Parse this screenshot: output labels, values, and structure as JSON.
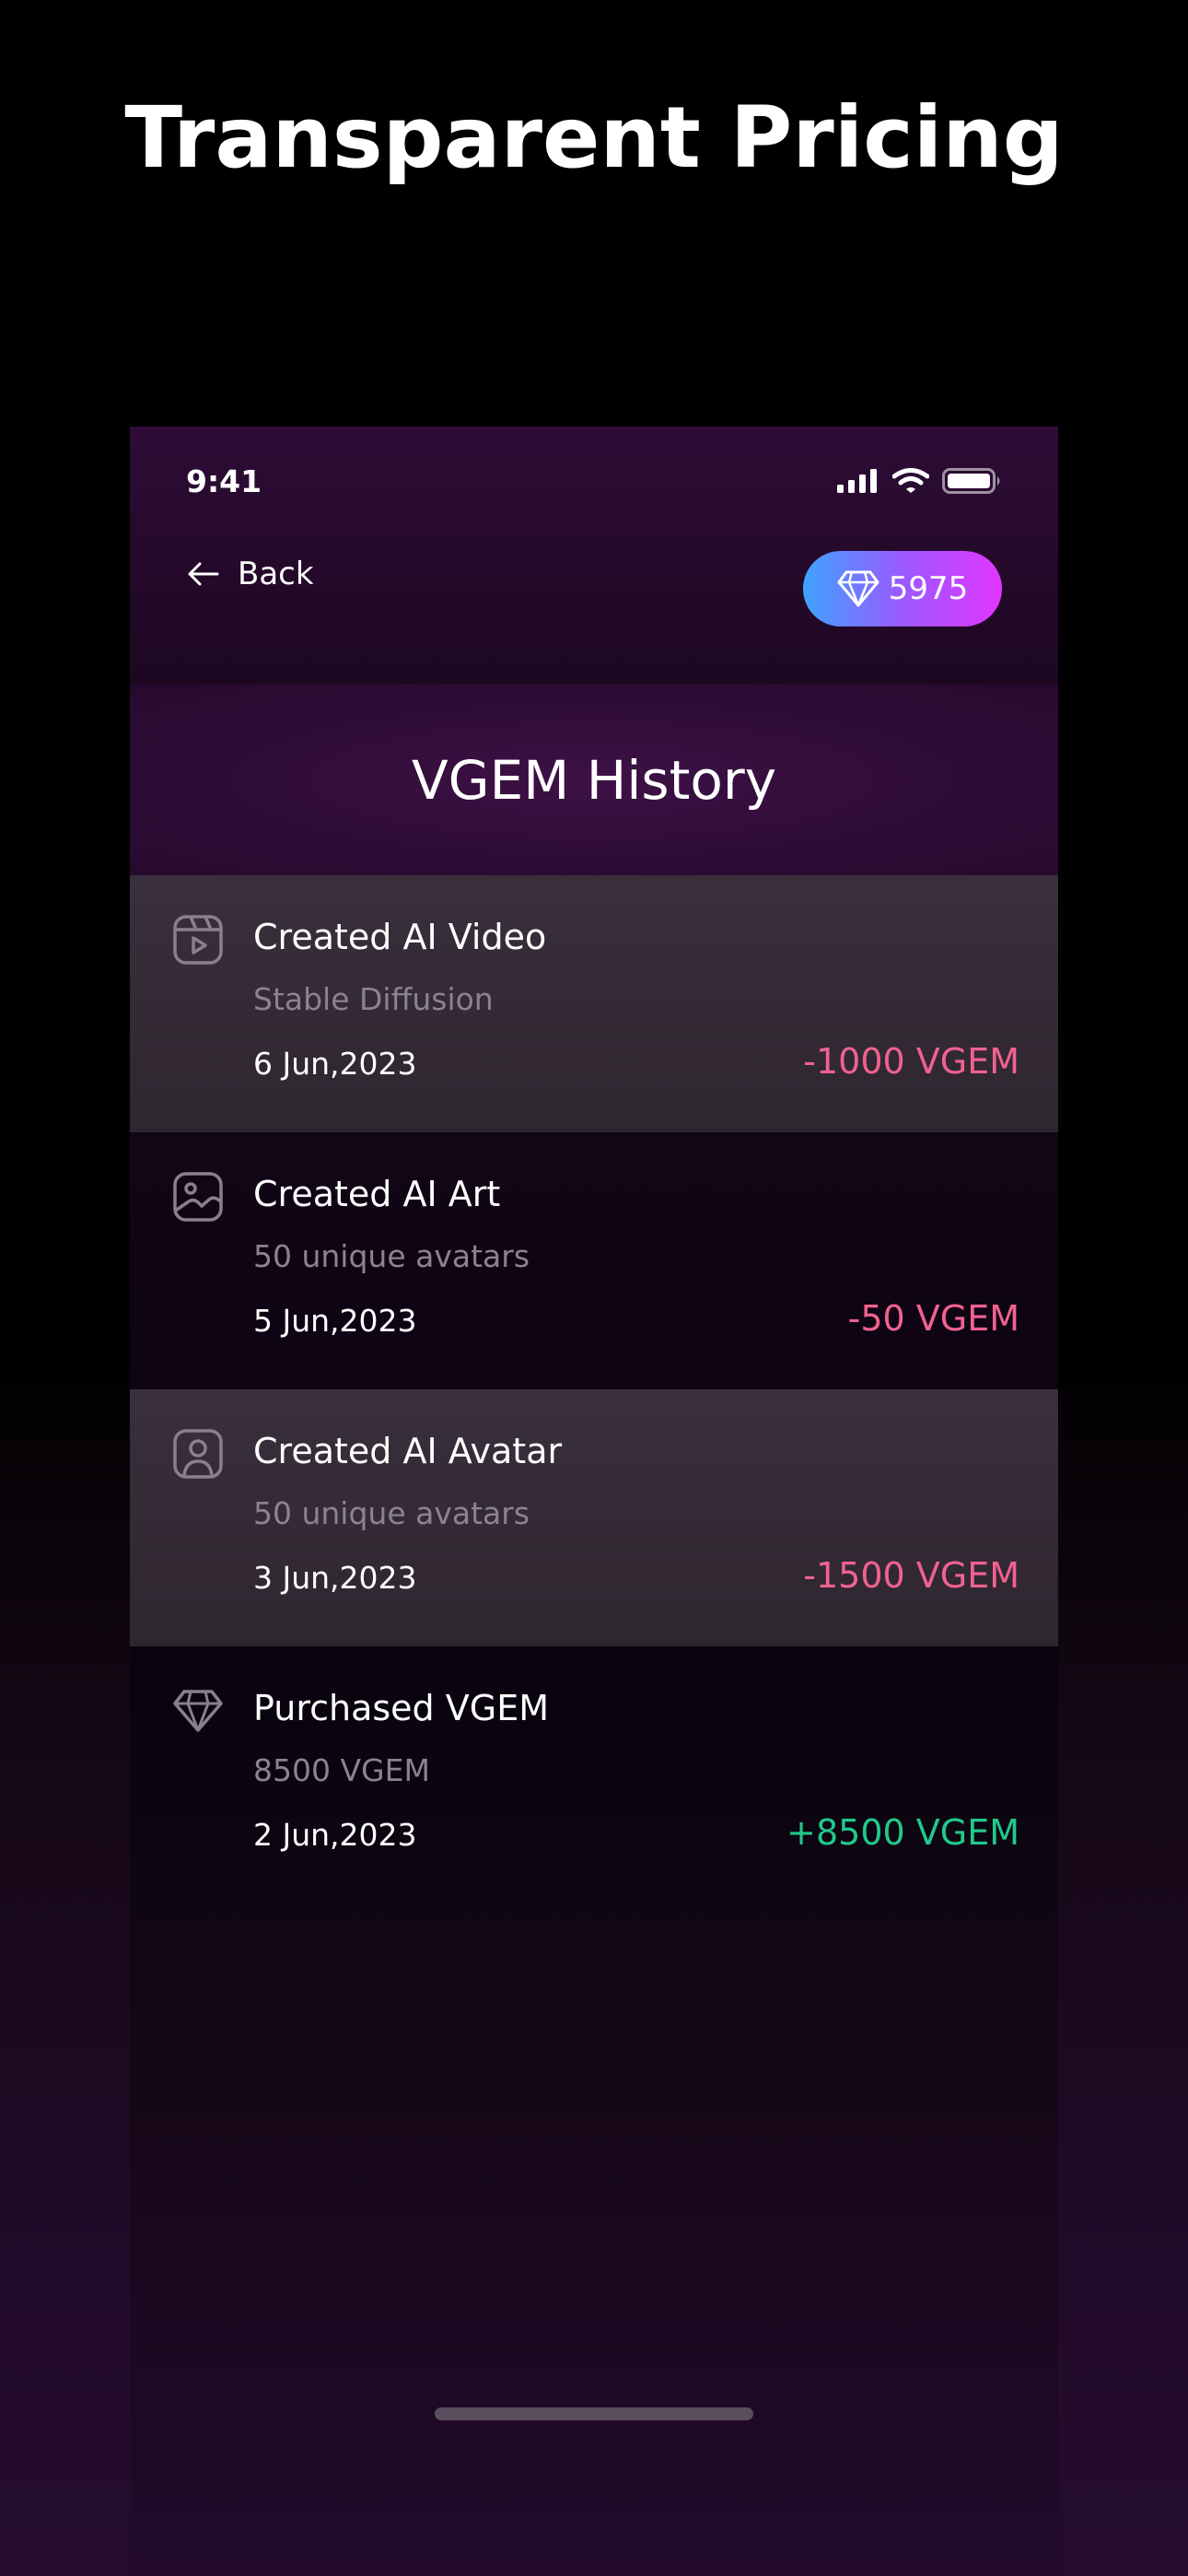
{
  "promo": {
    "title": "Transparent Pricing"
  },
  "status_bar": {
    "time": "9:41",
    "icons": [
      "cellular-signal-icon",
      "wifi-icon",
      "battery-icon"
    ]
  },
  "nav": {
    "back_label": "Back",
    "balance": "5975",
    "balance_icon": "diamond-icon"
  },
  "header": {
    "title": "VGEM History"
  },
  "history": [
    {
      "icon": "video-icon",
      "title": "Created AI Video",
      "subtitle": "Stable Diffusion",
      "date": "6 Jun,2023",
      "amount": "-1000 VGEM",
      "amount_type": "debit"
    },
    {
      "icon": "image-icon",
      "title": "Created AI Art",
      "subtitle": "50 unique avatars",
      "date": "5 Jun,2023",
      "amount": "-50 VGEM",
      "amount_type": "debit"
    },
    {
      "icon": "avatar-icon",
      "title": "Created AI Avatar",
      "subtitle": "50 unique avatars",
      "date": "3 Jun,2023",
      "amount": "-1500 VGEM",
      "amount_type": "debit"
    },
    {
      "icon": "diamond-icon",
      "title": "Purchased VGEM",
      "subtitle": "8500 VGEM",
      "date": "2 Jun,2023",
      "amount": "+8500 VGEM",
      "amount_type": "credit"
    }
  ],
  "colors": {
    "debit": "#f0628f",
    "credit": "#22c98a",
    "accent_gradient_start": "#3ea3ff",
    "accent_gradient_end": "#e136ff",
    "header_purple": "#2e0c36"
  }
}
